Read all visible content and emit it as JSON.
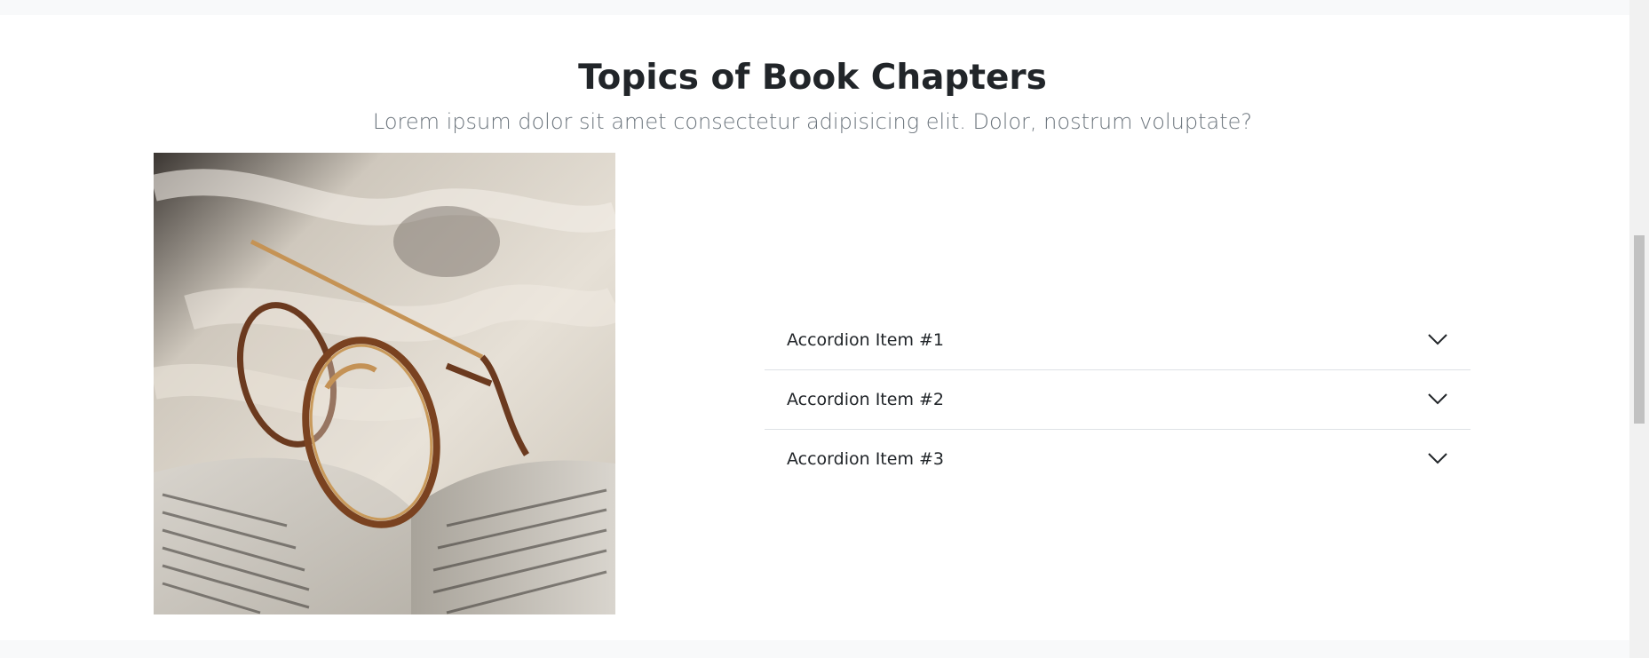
{
  "section": {
    "title": "Topics of Book Chapters",
    "subtitle": "Lorem ipsum dolor sit amet consectetur adipisicing elit. Dolor, nostrum voluptate?"
  },
  "image": {
    "subject": "round eyeglasses resting on an open book on a cream blanket"
  },
  "accordion": {
    "items": [
      {
        "label": "Accordion Item #1",
        "icon": "chevron-down-icon"
      },
      {
        "label": "Accordion Item #2",
        "icon": "chevron-down-icon"
      },
      {
        "label": "Accordion Item #3",
        "icon": "chevron-down-icon"
      }
    ]
  },
  "colors": {
    "page_bg": "#f8f9fa",
    "section_bg": "#ffffff",
    "title": "#212529",
    "subtitle": "#6c757d",
    "divider": "#dee2e6"
  }
}
